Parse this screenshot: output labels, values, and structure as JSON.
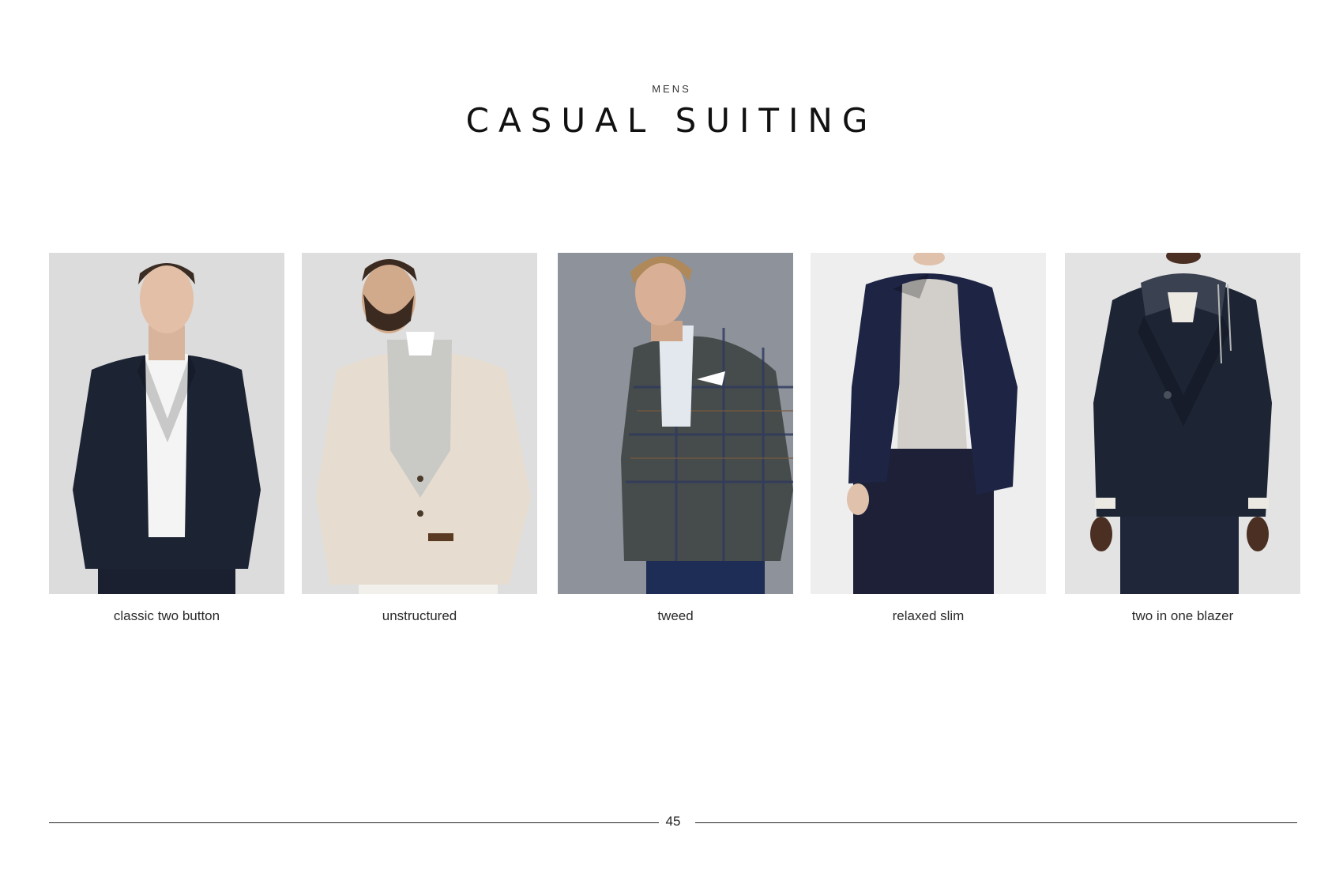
{
  "header": {
    "kicker": "MENS",
    "title": "CASUAL SUITING"
  },
  "products": [
    {
      "caption": "classic two button",
      "background": "#dcdcdc",
      "jacket_color": "#1c2333",
      "shirt_color": "#f4f4f4",
      "trouser_color": "#1b2030"
    },
    {
      "caption": "unstructured",
      "background": "#dedede",
      "jacket_color": "#e6ddd0",
      "shirt_color": "#c9c9c6",
      "trouser_color": "#f2f0ea"
    },
    {
      "caption": "tweed",
      "background": "#8d929b",
      "jacket_color": "#464b4c",
      "shirt_color": "#e3e8ee",
      "trouser_color": "#1e2d55"
    },
    {
      "caption": "relaxed slim",
      "background": "#eeeeee",
      "jacket_color": "#1e2544",
      "shirt_color": "#d2cfcb",
      "trouser_color": "#1d2037"
    },
    {
      "caption": "two in one blazer",
      "background": "#e3e3e3",
      "jacket_color": "#1d2535",
      "shirt_color": "#ece9e3",
      "trouser_color": "#20263a"
    }
  ],
  "footer": {
    "page_number": "45"
  }
}
